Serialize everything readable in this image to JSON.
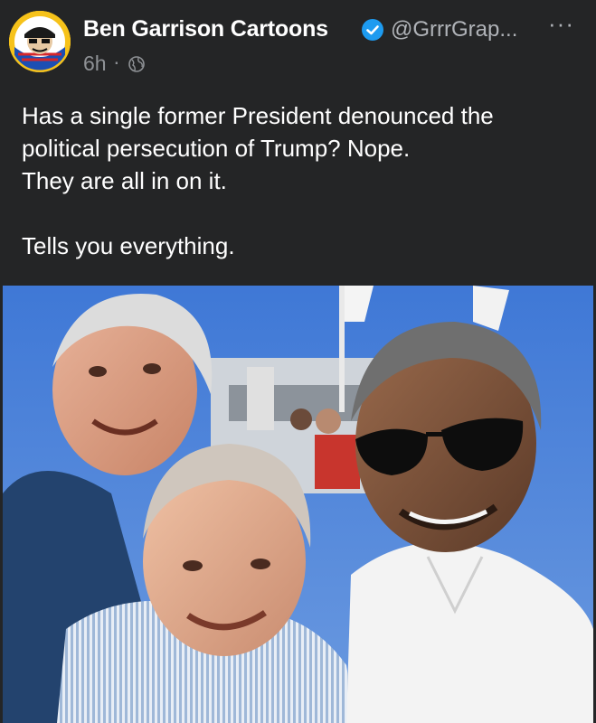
{
  "post": {
    "author_name": "Ben Garrison Cartoons",
    "handle": "@GrrrGrap...",
    "timestamp": "6h",
    "separator": "·",
    "audience": "globe-icon",
    "more_menu": "···",
    "verified": "verified-badge-icon",
    "text_lines": [
      "Has a single former President denounced the",
      "political persecution of Trump? Nope.",
      "They are all in on it.",
      "",
      "Tells you everything."
    ]
  },
  "colors": {
    "background": "#242526",
    "name": "#ffffff",
    "secondary": "#b0b3b8",
    "verified": "#1d9bf0"
  }
}
